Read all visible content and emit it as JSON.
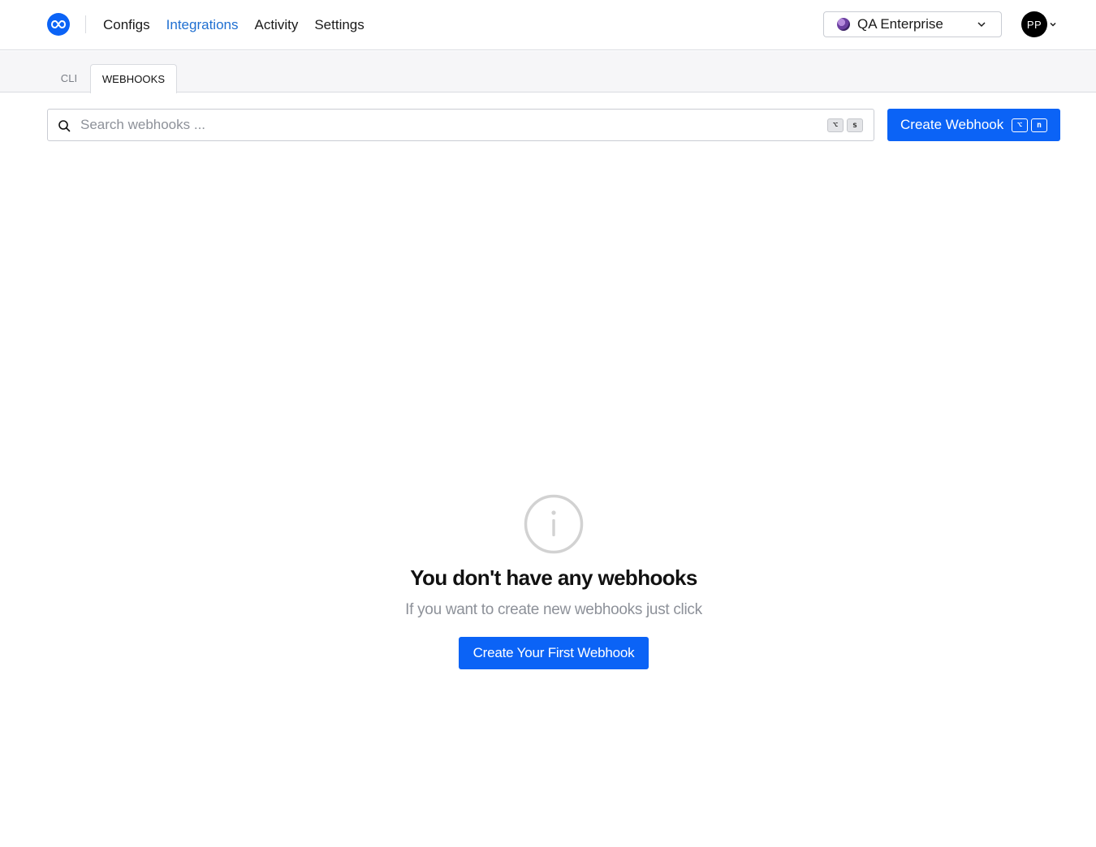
{
  "nav": {
    "links": [
      {
        "label": "Configs",
        "active": false
      },
      {
        "label": "Integrations",
        "active": true
      },
      {
        "label": "Activity",
        "active": false
      },
      {
        "label": "Settings",
        "active": false
      }
    ]
  },
  "org_selector": {
    "name": "QA Enterprise"
  },
  "user": {
    "initials": "PP"
  },
  "tabs": [
    {
      "label": "CLI",
      "active": false
    },
    {
      "label": "WEBHOOKS",
      "active": true
    }
  ],
  "search": {
    "placeholder": "Search webhooks ...",
    "value": "",
    "shortcut_keys": [
      "⌥",
      "s"
    ]
  },
  "create_button": {
    "label": "Create Webhook",
    "shortcut_keys": [
      "⌥",
      "n"
    ]
  },
  "empty_state": {
    "icon": "info-circle-icon",
    "title": "You don't have any webhooks",
    "subtitle": "If you want to create new webhooks just click",
    "button_label": "Create Your First Webhook"
  },
  "colors": {
    "accent": "#0b63f6",
    "active_link": "#1f6fd1",
    "muted_text": "#8d9199",
    "border": "#d9dbe0"
  }
}
